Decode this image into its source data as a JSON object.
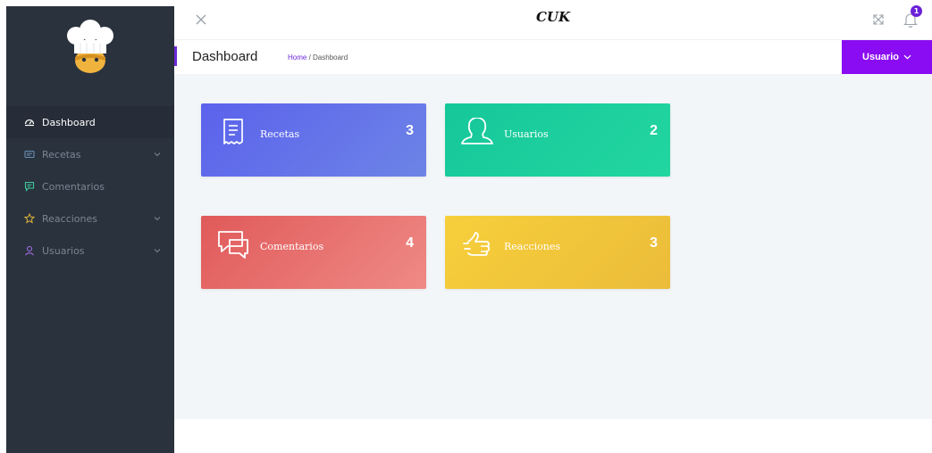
{
  "brand": "CUK",
  "notifications": {
    "count": "1"
  },
  "sidebar": {
    "items": [
      {
        "label": "Dashboard",
        "icon": "dashboard-icon",
        "active": true,
        "has_submenu": false
      },
      {
        "label": "Recetas",
        "icon": "card-icon",
        "active": false,
        "has_submenu": true
      },
      {
        "label": "Comentarios",
        "icon": "chat-icon",
        "active": false,
        "has_submenu": false
      },
      {
        "label": "Reacciones",
        "icon": "star-icon",
        "active": false,
        "has_submenu": true
      },
      {
        "label": "Usuarios",
        "icon": "user-icon",
        "active": false,
        "has_submenu": true
      }
    ]
  },
  "header": {
    "title": "Dashboard",
    "breadcrumb": {
      "home": "Home",
      "separator": " / ",
      "current": "Dashboard"
    },
    "user_button": "Usuario"
  },
  "cards": [
    {
      "label": "Recetas",
      "value": "3",
      "icon": "receipt-icon"
    },
    {
      "label": "Usuarios",
      "value": "2",
      "icon": "user-icon"
    },
    {
      "label": "Comentarios",
      "value": "4",
      "icon": "chat-bubbles-icon"
    },
    {
      "label": "Reacciones",
      "value": "3",
      "icon": "thumbs-up-icon"
    }
  ],
  "colors": {
    "sidebar": "#2a323e",
    "accent": "#8a0cf2",
    "recetas": "#5b62ec",
    "usuarios": "#16c79a",
    "comentarios": "#e05a5a",
    "reacciones": "#f7cf3b"
  }
}
